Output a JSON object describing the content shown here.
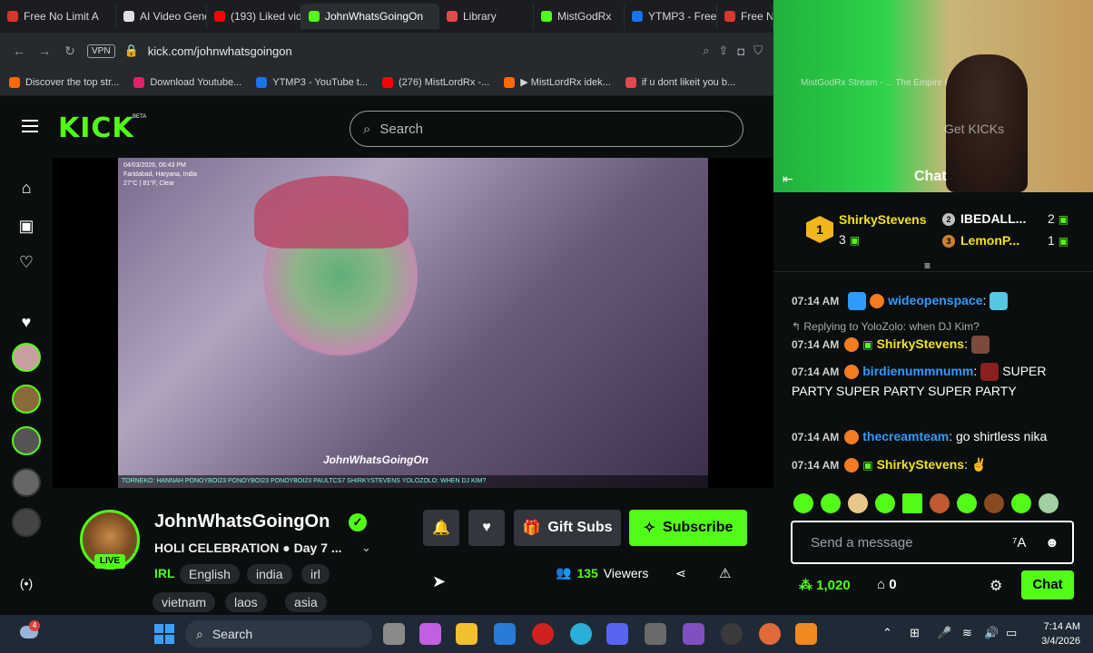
{
  "browser": {
    "tabs": [
      {
        "title": "Free No Limit A",
        "color": "#d6372e"
      },
      {
        "title": "AI Video Gener",
        "color": "#e0e0e0"
      },
      {
        "title": "(193) Liked vid",
        "color": "#ff0000"
      },
      {
        "title": "JohnWhatsGoingOn",
        "color": "#53fc18",
        "active": true
      },
      {
        "title": "Library",
        "color": "#e5484d"
      },
      {
        "title": "MistGodRx",
        "color": "#53fc18"
      },
      {
        "title": "YTMP3 - Free",
        "color": "#1a73e8"
      },
      {
        "title": "Free No Limit",
        "color": "#d6372e"
      }
    ],
    "vpn_label": "VPN",
    "url": "kick.com/johnwhatsgoingon",
    "bookmarks": [
      {
        "label": "Discover the top str...",
        "color": "#ff6a00"
      },
      {
        "label": "Download Youtube...",
        "color": "#e2206b"
      },
      {
        "label": "YTMP3 - YouTube t...",
        "color": "#1a73e8"
      },
      {
        "label": "(276) MistLordRx -...",
        "color": "#ff0000"
      },
      {
        "label": "▶ MistLordRx idek...",
        "color": "#ff6a00"
      },
      {
        "label": "if u dont likeit you b...",
        "color": "#e5484d"
      }
    ]
  },
  "kick": {
    "logo": "KICK",
    "beta": "BETA",
    "search_placeholder": "Search"
  },
  "video": {
    "overlay_lines": [
      "04/03/2026, 06:43 PM",
      "Faridabad, Haryana, India",
      "27°C | 81°F, Clear"
    ],
    "brand_text": "JohnWhatsGoingOn",
    "ticker": "TORNEKO: HANNAH  PONOYBOI23  PONOYBOI23  PONOYBOI23  PAULTCS7  SHIRKYSTEVENS  YOLOZOLO: WHEN DJ KIM?"
  },
  "channel": {
    "name": "JohnWhatsGoingOn",
    "live": "LIVE",
    "title": "HOLI CELEBRATION ● Day 7 ...",
    "category": "IRL",
    "tags": [
      "English",
      "india",
      "irl",
      "vietnam",
      "laos",
      "asia"
    ],
    "gift_subs": "Gift Subs",
    "subscribe": "Subscribe",
    "viewers_count": "135",
    "viewers_label": "Viewers"
  },
  "chat": {
    "header": "Chat",
    "get_kicks": "Get KICKs",
    "webcam_tabs": "MistGodRx Stream - ...   The Empire Lose: Pr...",
    "leaderboard": [
      {
        "rank": "1",
        "name": "ShirkyStevens",
        "count": "3",
        "rank_color": "#f2b51c"
      },
      {
        "rank": "2",
        "name": "IBEDALL...",
        "count": "2",
        "rank_color": "#c0c0c0"
      },
      {
        "rank": "3",
        "name": "LemonP...",
        "count": "1",
        "rank_color": "#cd7f32"
      }
    ],
    "messages": [
      {
        "time": "07:14 AM",
        "user": "wideopenspace",
        "user_color": "#2f9bff",
        "text": ":"
      },
      {
        "reply": "Replying to YoloZolo: when DJ Kim?"
      },
      {
        "time": "07:14 AM",
        "user": "ShirkyStevens",
        "user_color": "#f2e21a",
        "text": ":"
      },
      {
        "time": "07:14 AM",
        "user": "birdienummnumm",
        "user_color": "#2f9bff",
        "text": "SUPER PARTY  SUPER PARTY  SUPER PARTY"
      },
      {
        "time": "07:14 AM",
        "user": "thecreamteam",
        "user_color": "#2f9bff",
        "text": "go shirtless nika"
      },
      {
        "time": "07:14 AM",
        "user": "ShirkyStevens",
        "user_color": "#f2e21a",
        "text": ":"
      }
    ],
    "input_placeholder": "Send a message",
    "kicks_balance": "1,020",
    "gift_balance": "0",
    "send_button": "Chat"
  },
  "taskbar": {
    "search_label": "Search",
    "time": "7:14 AM",
    "date": "3/4/2026",
    "notification_count": "4"
  }
}
